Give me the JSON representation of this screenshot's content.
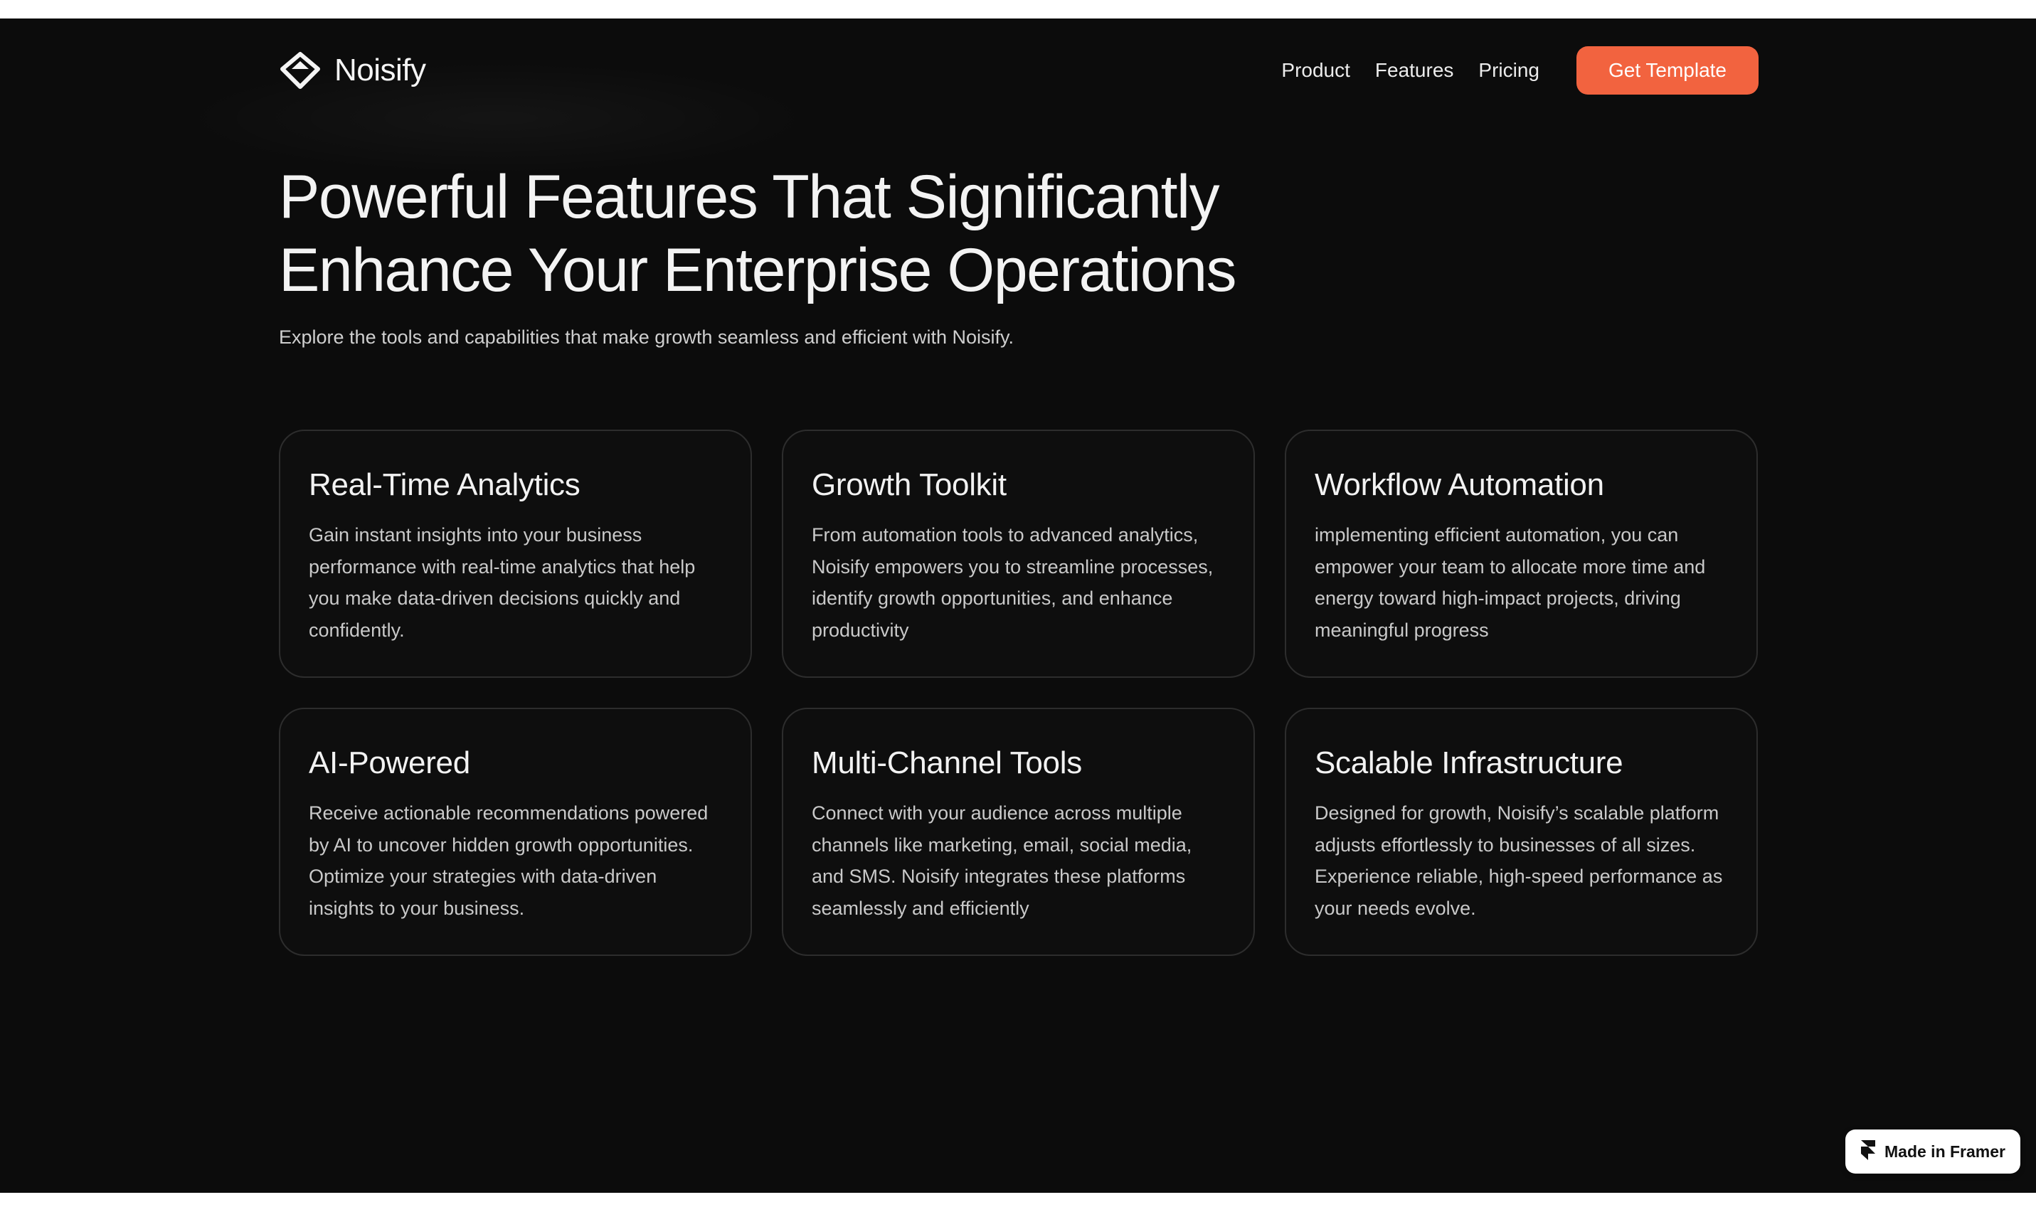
{
  "header": {
    "brand": "Noisify",
    "nav": [
      "Product",
      "Features",
      "Pricing"
    ],
    "cta": "Get Template",
    "logo_icon": "noisify-logo-icon"
  },
  "hero": {
    "title_lines": [
      "Powerful Features That Significantly",
      "Enhance Your Enterprise Operations"
    ],
    "subtitle": "Explore the tools and capabilities that make growth seamless and efficient with Noisify."
  },
  "features": [
    {
      "title": "Real-Time Analytics",
      "description": "Gain instant insights into your business performance with real-time analytics that help you make data-driven decisions quickly and confidently."
    },
    {
      "title": "Growth Toolkit",
      "description": "From automation tools to advanced analytics, Noisify empowers you to streamline processes, identify growth opportunities, and enhance productivity"
    },
    {
      "title": "Workflow Automation",
      "description": "implementing efficient automation, you can empower your team to allocate more time and energy toward high-impact projects, driving meaningful progress"
    },
    {
      "title": "AI-Powered",
      "description": "Receive actionable recommendations powered by AI to uncover hidden growth opportunities. Optimize your strategies with data-driven insights to your business."
    },
    {
      "title": "Multi-Channel Tools",
      "description": "Connect with your audience across multiple channels like marketing, email, social media, and SMS. Noisify integrates these platforms seamlessly and efficiently"
    },
    {
      "title": "Scalable Infrastructure",
      "description": "Designed for growth, Noisify’s scalable platform adjusts effortlessly to businesses of all sizes. Experience reliable, high-speed performance as your needs evolve."
    }
  ],
  "badge": {
    "label": "Made in Framer",
    "icon": "framer-icon"
  },
  "colors": {
    "background": "#0c0c0c",
    "accent": "#f2633f",
    "card_border": "#2d2d2d"
  }
}
